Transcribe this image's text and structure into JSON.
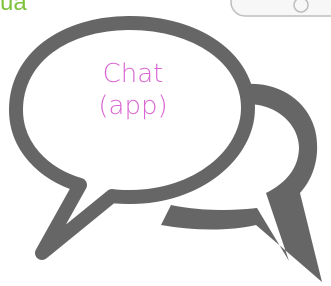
{
  "corner_text": "ua",
  "label": {
    "line1": "Chat",
    "line2": "(app)"
  },
  "icon": "chat-bubbles-icon",
  "colors": {
    "corner_text": "#7cc23b",
    "label": "#d966d2",
    "bubble_outline": "#666666",
    "bubble_fill": "#ffffff",
    "corner_widget_border": "#bdbdbd"
  }
}
